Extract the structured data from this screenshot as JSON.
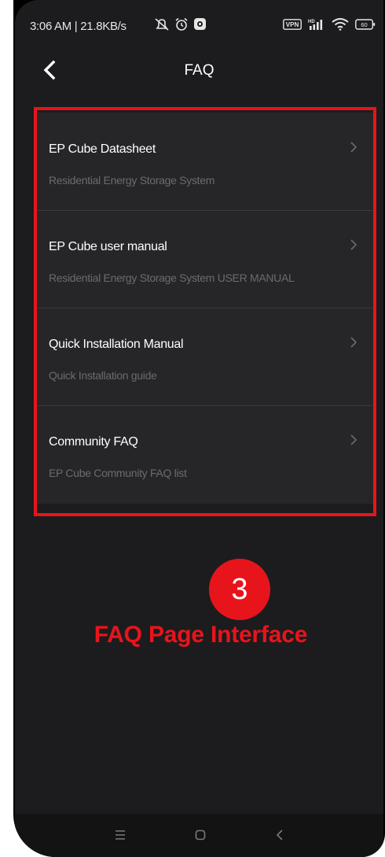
{
  "status_bar": {
    "time_info": "3:06 AM | 21.8KB/s",
    "icons_left": [
      "notifications-off-icon",
      "alarm-icon",
      "app-icon"
    ],
    "icons_right": [
      "vpn-icon",
      "hd-signal-icon",
      "wifi-icon",
      "battery-icon"
    ],
    "vpn_label": "VPN",
    "battery_level": "60"
  },
  "header": {
    "title": "FAQ",
    "back_icon": "chevron-left-icon"
  },
  "faq_items": [
    {
      "title": "EP Cube Datasheet",
      "subtitle": "Residential Energy Storage System"
    },
    {
      "title": "EP Cube user manual",
      "subtitle": "Residential Energy Storage System USER MANUAL"
    },
    {
      "title": "Quick Installation Manual",
      "subtitle": "Quick Installation guide"
    },
    {
      "title": "Community FAQ",
      "subtitle": "EP Cube Community FAQ list"
    }
  ],
  "annotation": {
    "step_number": "3",
    "caption": "FAQ Page Interface"
  },
  "system_nav": {
    "icons": [
      "menu-icon",
      "home-icon",
      "back-icon"
    ]
  },
  "colors": {
    "background": "#1c1c1e",
    "card": "#262628",
    "highlight": "#e8141b"
  }
}
